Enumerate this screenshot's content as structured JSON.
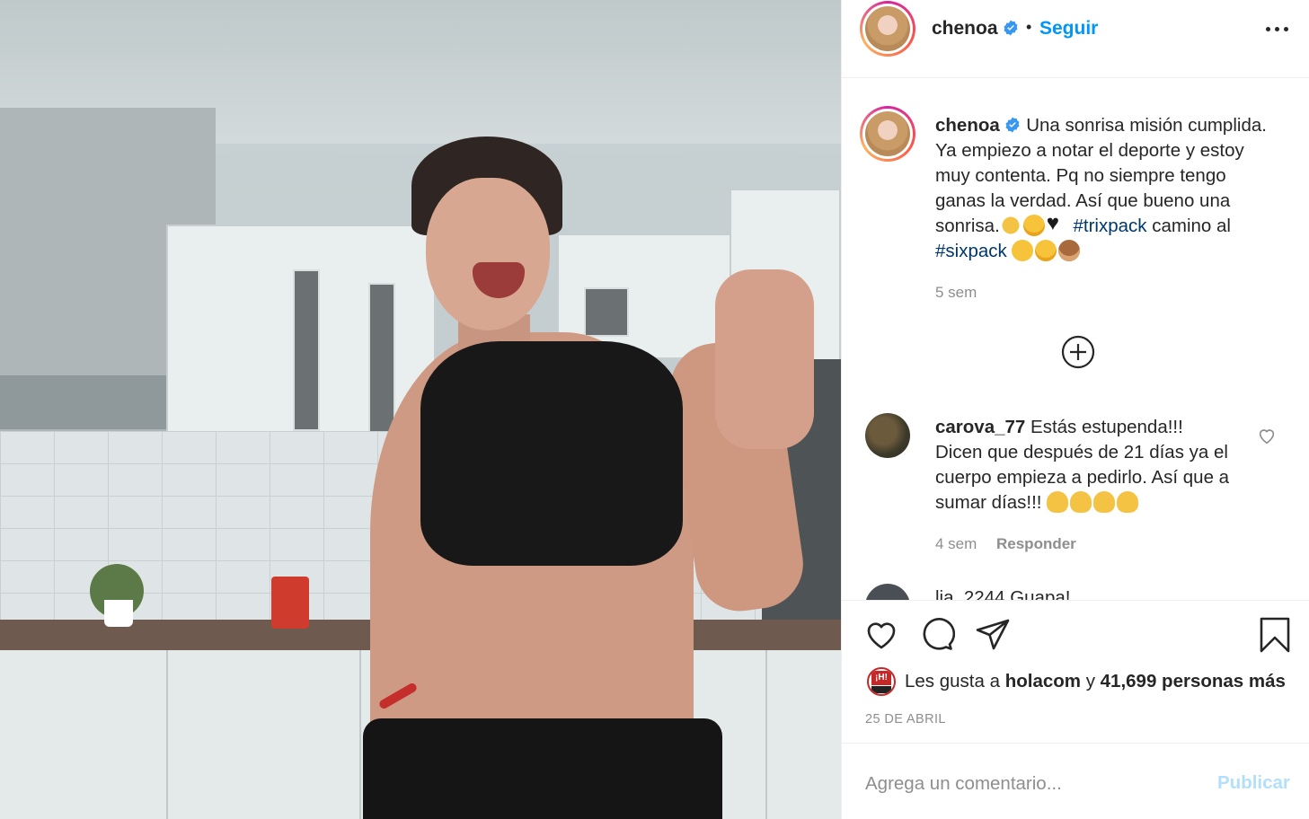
{
  "post": {
    "image_alt": "Woman in black sports top smiling and making a peace sign in a kitchen"
  },
  "header": {
    "username": "chenoa",
    "separator": "•",
    "follow_label": "Seguir"
  },
  "caption": {
    "username": "chenoa",
    "text": "Una sonrisa misión cumplida. Ya empiezo a notar el deporte y estoy muy contenta. Pq no siempre tengo ganas la verdad. Así que bueno una sonrisa.",
    "hashtag1": "#trixpack",
    "middle": "camino al",
    "hashtag2": "#sixpack",
    "time": "5 sem"
  },
  "comments": [
    {
      "username": "carova_77",
      "text": "Estás estupenda!!! Dicen que después de 21 días ya el cuerpo empieza a pedirlo. Así que a sumar días!!!",
      "time": "4 sem",
      "reply_label": "Responder"
    }
  ],
  "next_comment_partial": "lia_2244 Guapa!",
  "likes": {
    "prefix": "Les gusta a",
    "user": "holacom",
    "joiner": "y",
    "others": "41,699 personas más",
    "avatar_text": "¡H!"
  },
  "date": "25 DE ABRIL",
  "add_comment": {
    "placeholder": "Agrega un comentario...",
    "publish_label": "Publicar"
  },
  "icons": {
    "verified": "verified-badge-icon",
    "more": "more-options-icon",
    "load_more": "load-more-comments-icon",
    "like": "heart-icon",
    "comment": "comment-icon",
    "share": "paper-plane-icon",
    "save": "bookmark-icon"
  },
  "colors": {
    "link_blue": "#0095f6",
    "hashtag": "#00376b",
    "muted": "#8e8e8e",
    "publish_disabled": "#b2dffc",
    "verified": "#3897f0"
  }
}
